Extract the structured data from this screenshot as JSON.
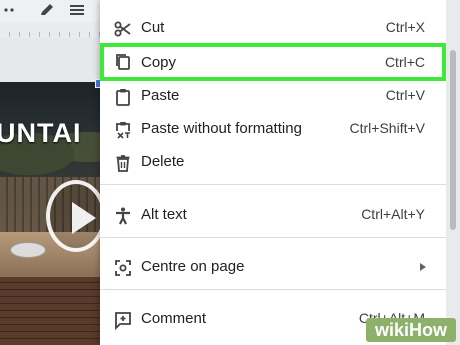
{
  "menu": {
    "items": [
      {
        "label": "Cut",
        "shortcut": "Ctrl+X",
        "icon": "scissors-icon"
      },
      {
        "label": "Copy",
        "shortcut": "Ctrl+C",
        "icon": "copy-icon",
        "highlighted": true
      },
      {
        "label": "Paste",
        "shortcut": "Ctrl+V",
        "icon": "clipboard-icon"
      },
      {
        "label": "Paste without formatting",
        "shortcut": "Ctrl+Shift+V",
        "icon": "clipboard-clear-icon"
      },
      {
        "label": "Delete",
        "shortcut": "",
        "icon": "trash-icon"
      },
      {
        "label": "Alt text",
        "shortcut": "Ctrl+Alt+Y",
        "icon": "accessibility-icon"
      },
      {
        "label": "Centre on page",
        "shortcut": "",
        "icon": "center-focus-icon",
        "submenu": true
      },
      {
        "label": "Comment",
        "shortcut": "Ctrl+Alt+M",
        "icon": "comment-add-icon"
      }
    ]
  },
  "background": {
    "banner_text": "UNTAI"
  },
  "watermark": {
    "prefix": "wiki",
    "suffix": "How"
  },
  "colors": {
    "highlight_border": "#3ee93a",
    "menu_background": "#ffffff",
    "selection_handle": "#4a7de1"
  }
}
